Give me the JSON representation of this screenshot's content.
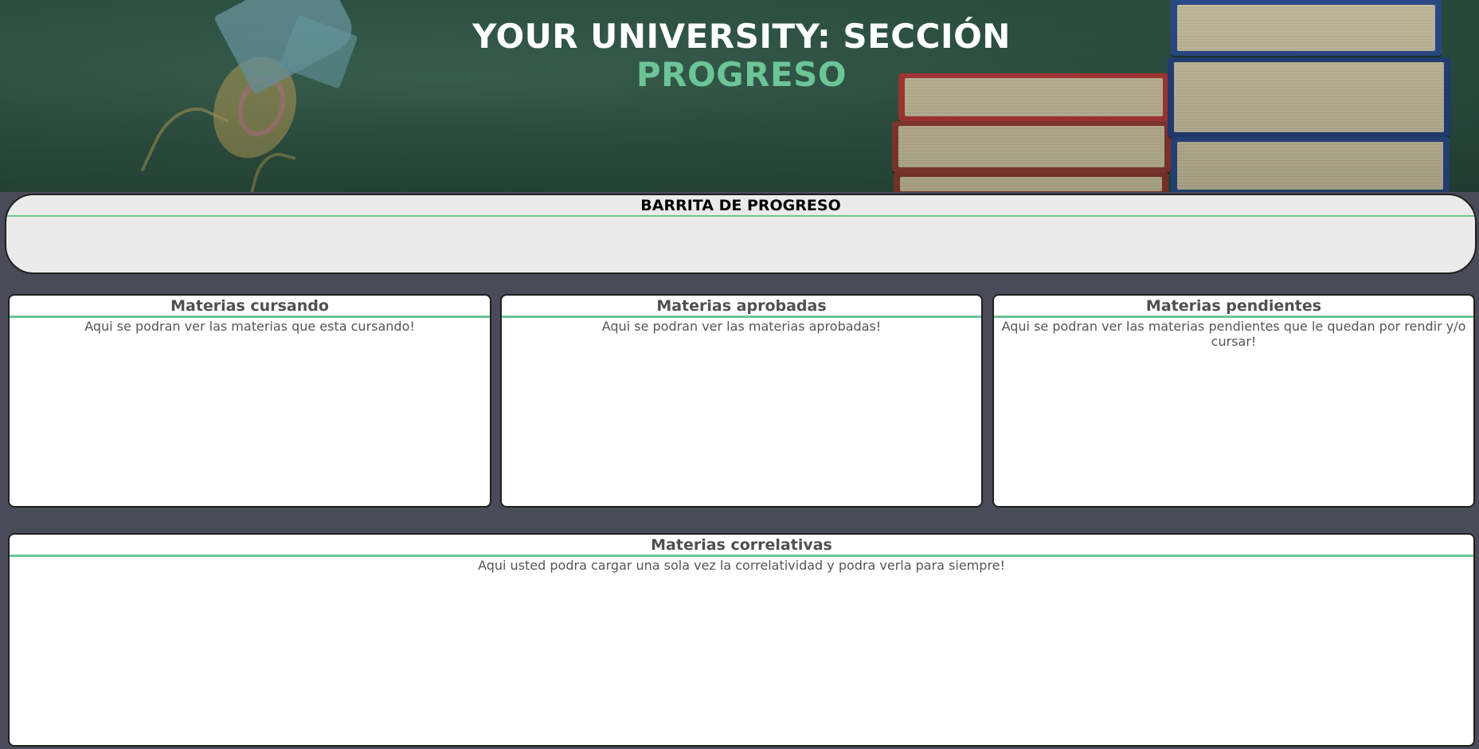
{
  "header": {
    "title_line1": "YOUR UNIVERSITY: SECCIÓN",
    "title_line2": "PROGRESO",
    "accent_color": "#6cc596"
  },
  "progress": {
    "title": "BARRITA DE PROGRESO"
  },
  "cards": [
    {
      "title": "Materias cursando",
      "body": "Aqui se podran ver las materias que esta cursando!"
    },
    {
      "title": "Materias aprobadas",
      "body": "Aqui se podran ver las materias aprobadas!"
    },
    {
      "title": "Materias pendientes",
      "body": "Aqui se podran ver las materias pendientes que le quedan por rendir y/o cursar!"
    },
    {
      "title": "Materias correlativas",
      "body": "Aqui usted podra cargar una sola vez la correlatividad y podra verla para siempre!"
    }
  ],
  "colors": {
    "background": "#4a4b58",
    "panel": "#ebebeb",
    "card": "#ffffff",
    "accent": "#6cc596"
  }
}
